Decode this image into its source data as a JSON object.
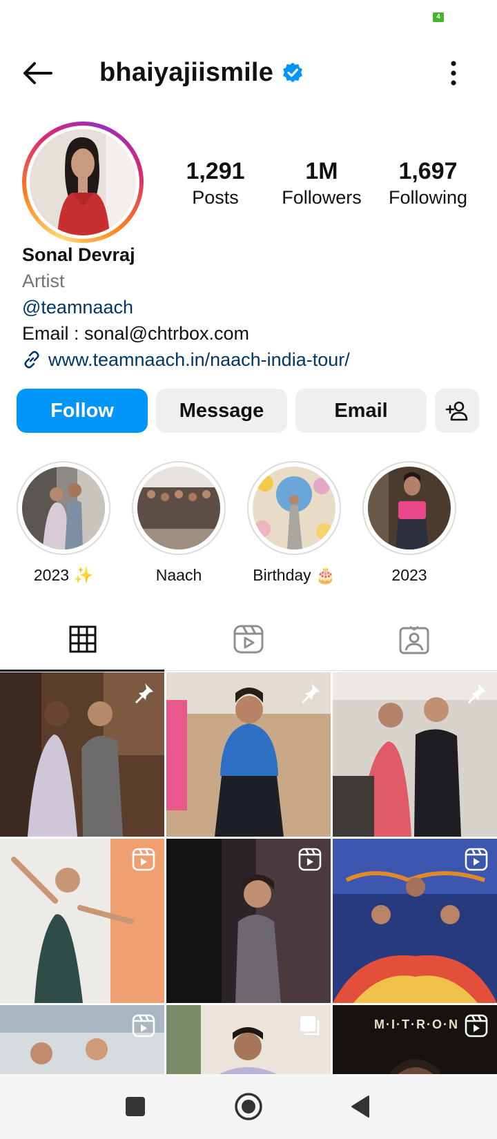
{
  "status_bar": {
    "battery": "4"
  },
  "header": {
    "username": "bhaiyajiismile",
    "verified": true
  },
  "profile": {
    "stats": [
      {
        "value": "1,291",
        "label": "Posts"
      },
      {
        "value": "1M",
        "label": "Followers"
      },
      {
        "value": "1,697",
        "label": "Following"
      }
    ],
    "name": "Sonal Devraj",
    "category": "Artist",
    "handle": "@teamnaach",
    "email": "Email : sonal@chtrbox.com",
    "link": "www.teamnaach.in/naach-india-tour/"
  },
  "actions": {
    "follow": "Follow",
    "message": "Message",
    "email": "Email"
  },
  "highlights": [
    {
      "label": "2023 ✨"
    },
    {
      "label": "Naach"
    },
    {
      "label": "Birthday 🎂"
    },
    {
      "label": "2023"
    }
  ],
  "tabs": [
    {
      "icon": "grid-icon",
      "active": true
    },
    {
      "icon": "reels-icon",
      "active": false
    },
    {
      "icon": "tagged-icon",
      "active": false
    }
  ],
  "grid_items": [
    {
      "badge": "pin-icon",
      "overlay_text": ""
    },
    {
      "badge": "pin-icon",
      "overlay_text": ""
    },
    {
      "badge": "pin-icon",
      "overlay_text": ""
    },
    {
      "badge": "reel-icon",
      "overlay_text": ""
    },
    {
      "badge": "reel-icon",
      "overlay_text": ""
    },
    {
      "badge": "reel-icon",
      "overlay_text": ""
    },
    {
      "badge": "reel-icon",
      "overlay_text": ""
    },
    {
      "badge": "carousel-icon",
      "overlay_text": ""
    },
    {
      "badge": "reel-icon",
      "overlay_text": "M·I·T·R·O·N"
    }
  ],
  "colors": {
    "accent": "#0095f6",
    "link": "#00376b",
    "verified": "#0095f6",
    "secondary_text": "#737373"
  }
}
